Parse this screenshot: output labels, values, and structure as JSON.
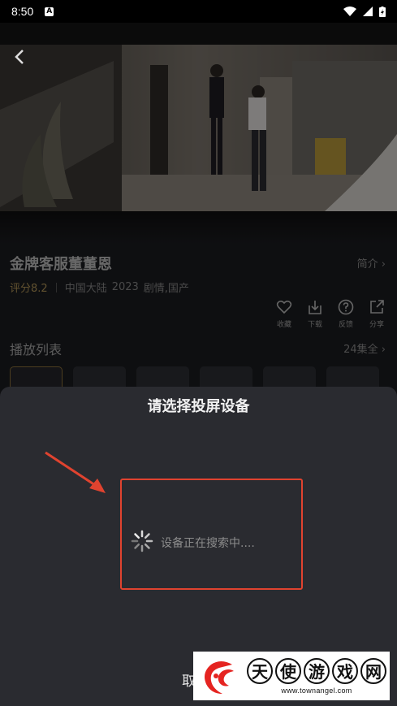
{
  "status_bar": {
    "time": "8:50",
    "notification_badge": "A"
  },
  "show": {
    "title": "金牌客服董董恩",
    "intro_link": "简介 ›",
    "score": "评分8.2",
    "region": "中国大陆",
    "year": "2023",
    "genre": "剧情,国产"
  },
  "actions": [
    {
      "icon": "heart-icon",
      "label": "收藏"
    },
    {
      "icon": "download-icon",
      "label": "下载"
    },
    {
      "icon": "question-icon",
      "label": "反馈"
    },
    {
      "icon": "share-icon",
      "label": "分享"
    }
  ],
  "playlist": {
    "title": "播放列表",
    "episodes_link": "24集全 ›"
  },
  "cast_sheet": {
    "title": "请选择投屏设备",
    "searching_text": "设备正在搜索中....",
    "cancel_label": "取"
  },
  "watermark": {
    "chars": [
      "天",
      "使",
      "游",
      "戏",
      "网"
    ],
    "url": "www.townangel.com"
  },
  "colors": {
    "highlight_border": "#e0432f",
    "score": "#b39658",
    "sheet_bg": "#2a2b30"
  }
}
